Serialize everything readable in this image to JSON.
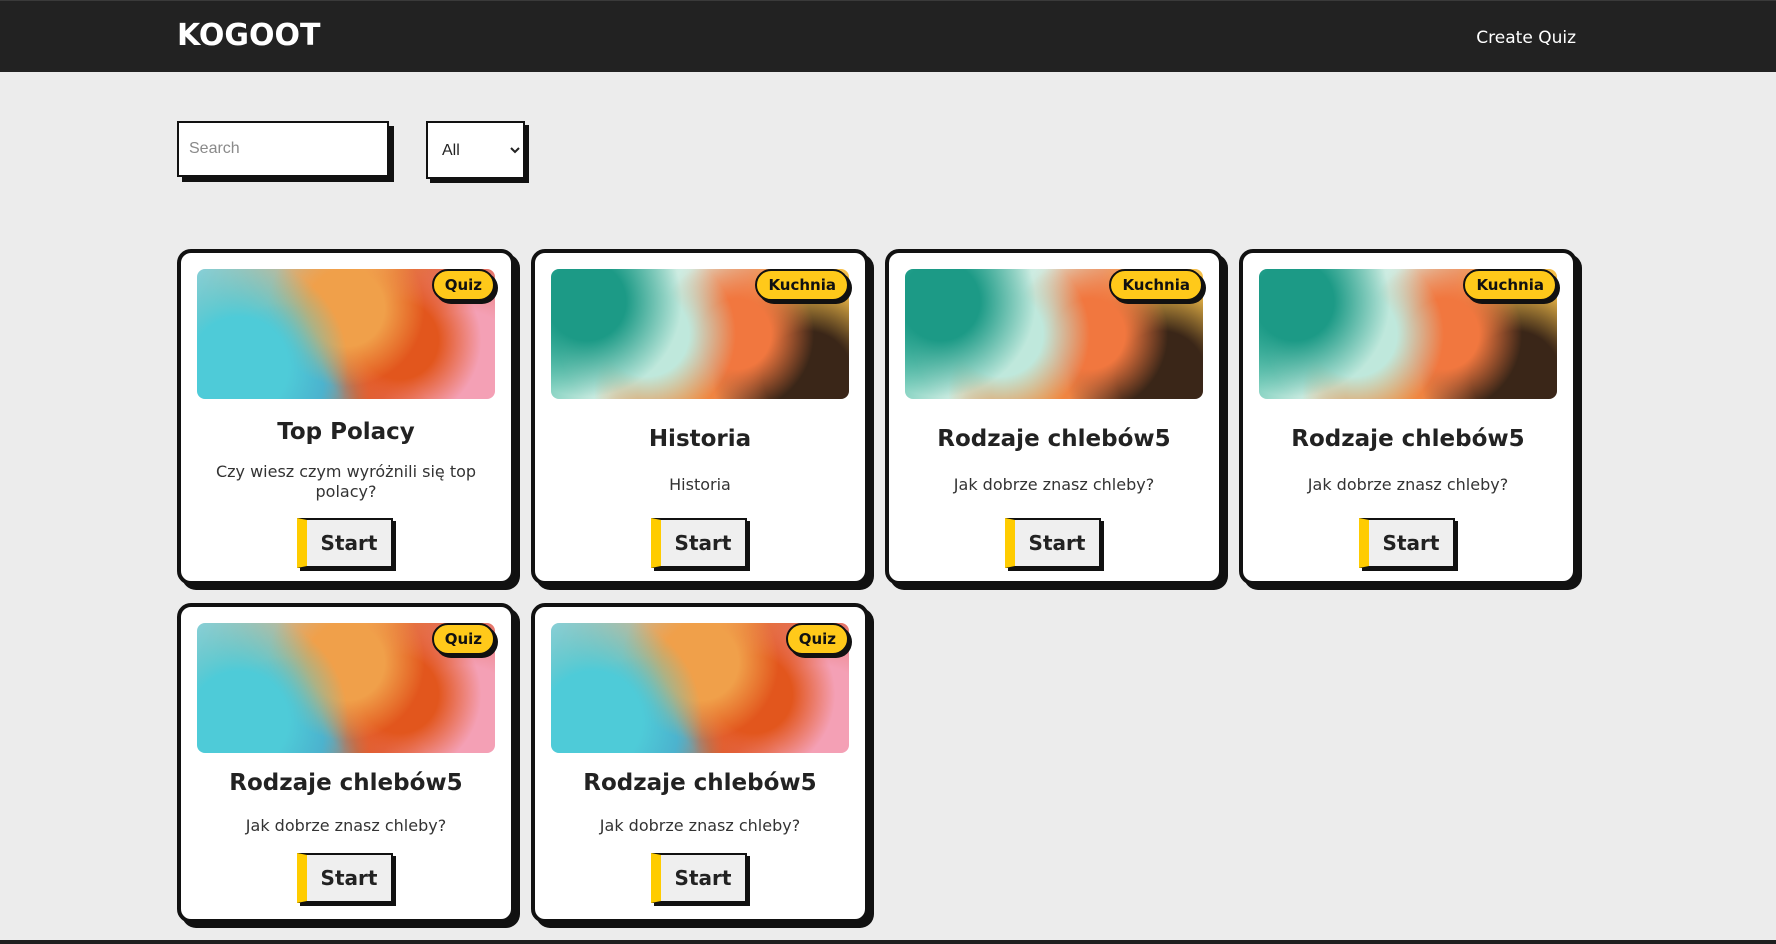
{
  "header": {
    "brand": "KOGOOT",
    "create_quiz": "Create Quiz"
  },
  "filters": {
    "search_placeholder": "Search",
    "search_value": "",
    "category_selected": "All"
  },
  "cards": [
    {
      "badge": "Quiz",
      "title": "Top Polacy",
      "description": "Czy wiesz czym wyróżnili się top polacy?",
      "button": "Start"
    },
    {
      "badge": "Kuchnia",
      "title": "Historia",
      "description": "Historia",
      "button": "Start"
    },
    {
      "badge": "Kuchnia",
      "title": "Rodzaje chlebów5",
      "description": "Jak dobrze znasz chleby?",
      "button": "Start"
    },
    {
      "badge": "Kuchnia",
      "title": "Rodzaje chlebów5",
      "description": "Jak dobrze znasz chleby?",
      "button": "Start"
    },
    {
      "badge": "Quiz",
      "title": "Rodzaje chlebów5",
      "description": "Jak dobrze znasz chleby?",
      "button": "Start"
    },
    {
      "badge": "Quiz",
      "title": "Rodzaje chlebów5",
      "description": "Jak dobrze znasz chleby?",
      "button": "Start"
    }
  ],
  "colors": {
    "navbar": "#222222",
    "background": "#ececec",
    "accent": "#ffc91a"
  }
}
